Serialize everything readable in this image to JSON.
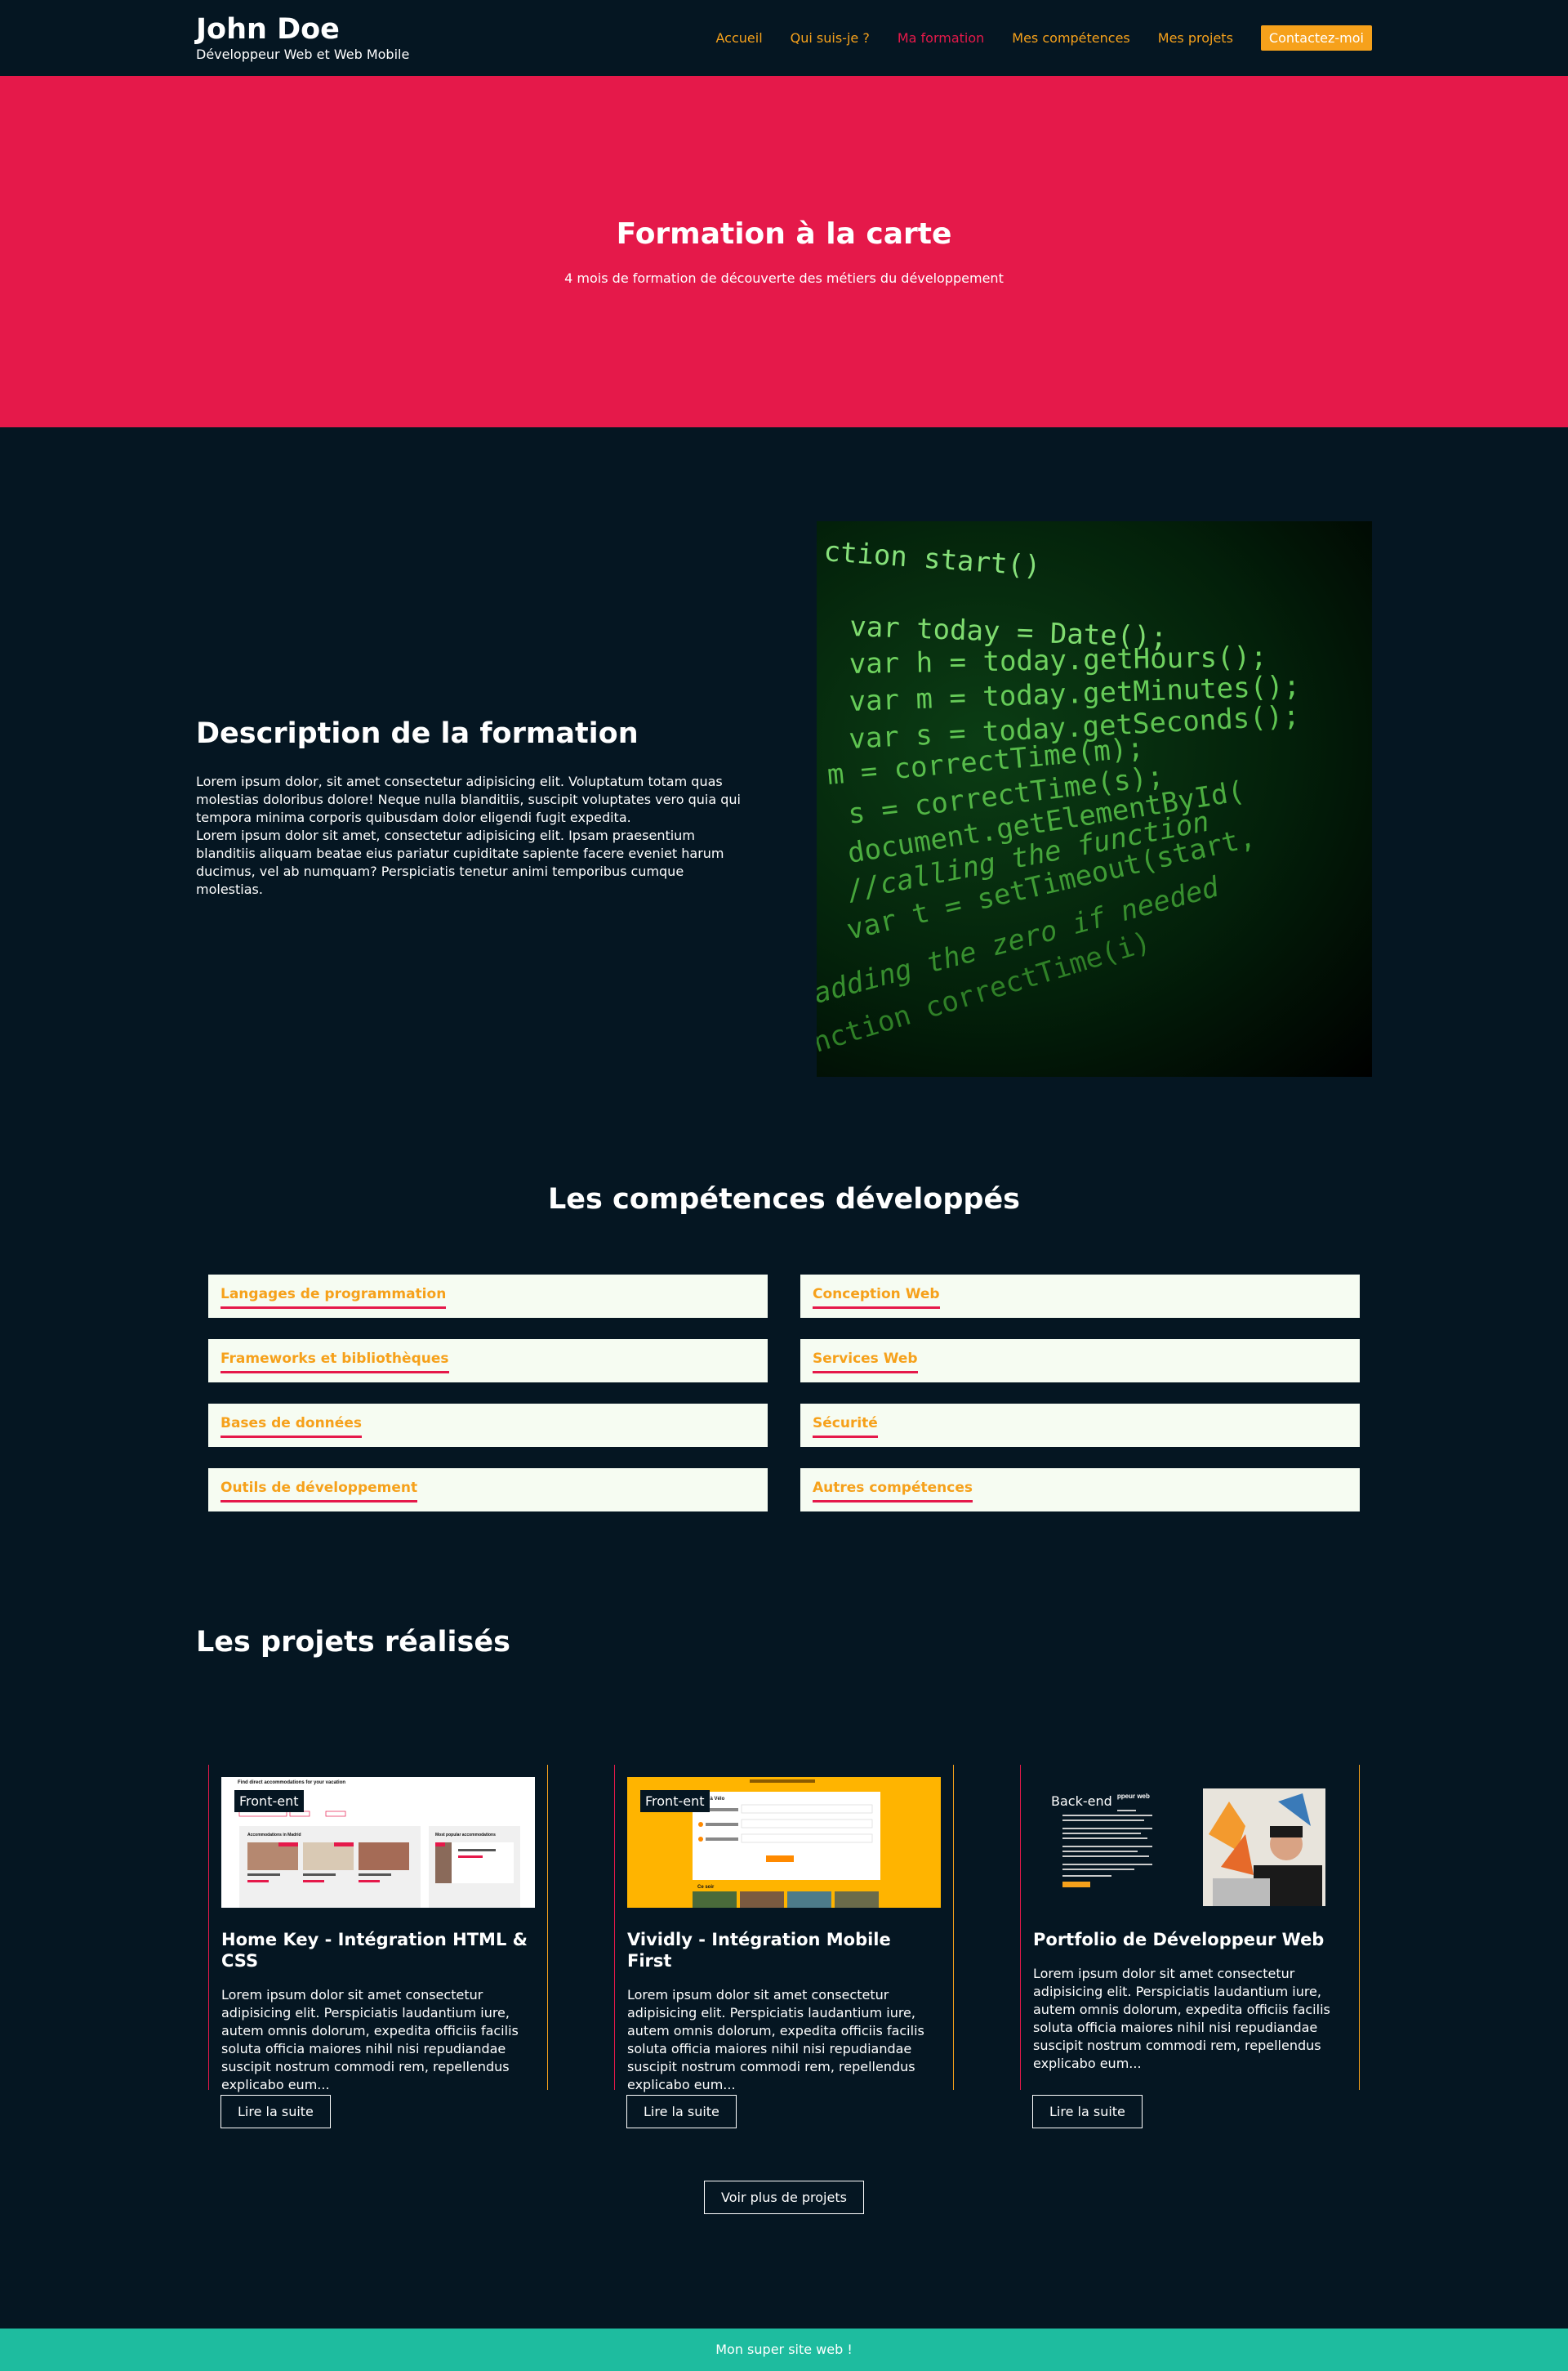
{
  "brand": {
    "name": "John Doe",
    "subtitle": "Développeur Web et Web Mobile"
  },
  "nav": {
    "items": [
      "Accueil",
      "Qui suis-je ?",
      "Ma formation",
      "Mes compétences",
      "Mes projets"
    ],
    "active": "Ma formation",
    "cta": "Contactez-moi"
  },
  "hero": {
    "title": "Formation à la carte",
    "subtitle": "4 mois de formation de découverte des métiers du développement"
  },
  "description": {
    "title": "Description de la formation",
    "paragraphs": [
      "Lorem ipsum dolor, sit amet consectetur adipisicing elit. Voluptatum totam quas molestias doloribus dolore! Neque nulla blanditiis, suscipit voluptates vero quia qui tempora minima corporis quibusdam dolor eligendi fugit expedita.",
      "Lorem ipsum dolor sit amet, consectetur adipisicing elit. Ipsam praesentium blanditiis aliquam beatae eius pariatur cupiditate sapiente facere eveniet harum ducimus, vel ab numquam? Perspiciatis tenetur animi temporibus cumque molestias."
    ],
    "code_lines": [
      "ction start()",
      "var today = Date();",
      "var h = today.getHours();",
      "var m = today.getMinutes();",
      "var s = today.getSeconds();",
      "m = correctTime(m);",
      "s = correctTime(s);",
      "document.getElementById(",
      "//calling the function",
      "var t = setTimeout(start,",
      "adding the zero if needed",
      "nction correctTime(i)"
    ]
  },
  "skills": {
    "title": "Les compétences développés",
    "items": [
      "Langages de programmation",
      "Conception Web",
      "Frameworks et bibliothèques",
      "Services Web",
      "Bases de données",
      "Sécurité",
      "Outils de développement",
      "Autres compétences"
    ]
  },
  "projects": {
    "title": "Les projets réalisés",
    "cards": [
      {
        "tag": "Front-ent",
        "title": "Home Key - Intégration HTML & CSS",
        "text": "Lorem ipsum dolor sit amet consectetur adipisicing elit. Perspiciatis laudantium iure, autem omnis dolorum, expedita officiis facilis soluta officia maiores nihil nisi repudiandae suscipit nostrum commodi rem, repellendus explicabo eum...",
        "button": "Lire la suite",
        "thumb_texts": [
          "Find direct accommodations for your vacation",
          "Accommodations in Madrid",
          "Most popular accommodations"
        ]
      },
      {
        "tag": "Front-ent",
        "title": "Vividly - Intégration Mobile First",
        "text": "Lorem ipsum dolor sit amet consectetur adipisicing elit. Perspiciatis laudantium iure, autem omnis dolorum, expedita officiis facilis soluta officia maiores nihil nisi repudiandae suscipit nostrum commodi rem, repellendus explicabo eum...",
        "button": "Lire la suite",
        "thumb_texts": [
          "Tous à Vélo",
          "Ce soir"
        ]
      },
      {
        "tag": "Back-end",
        "title": "Portfolio de Développeur Web",
        "text": "Lorem ipsum dolor sit amet consectetur adipisicing elit. Perspiciatis laudantium iure, autem omnis dolorum, expedita officiis facilis soluta officia maiores nihil nisi repudiandae suscipit nostrum commodi rem, repellendus explicabo eum...",
        "button": "Lire la suite",
        "thumb_texts": [
          "oppeur web"
        ]
      }
    ],
    "more_button": "Voir plus de projets"
  },
  "footer": {
    "text": "Mon super site web !"
  },
  "colors": {
    "background": "#051622",
    "accent_red": "#e5194a",
    "accent_orange": "#f6a11b",
    "skill_bg": "#f6fcf2",
    "footer": "#1ebc9f"
  }
}
